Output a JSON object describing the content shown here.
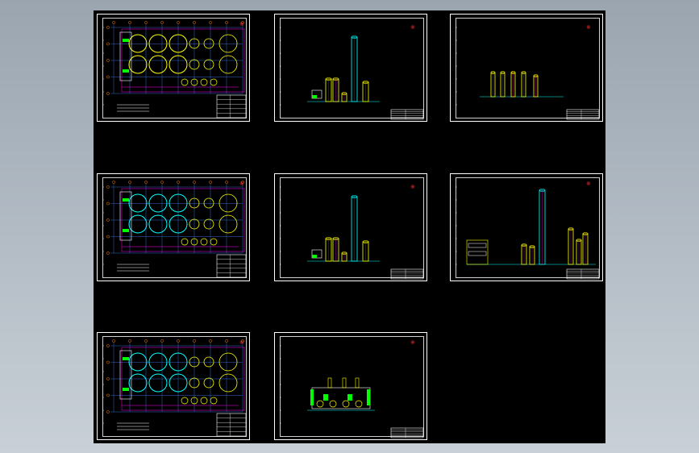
{
  "view": {
    "background": "#000000",
    "frame_color": "#ffffff",
    "accent_colors": [
      "#00ffff",
      "#ffff00",
      "#ff00ff",
      "#ff3333",
      "#00ff00",
      "#ffffff"
    ]
  },
  "sheets": [
    {
      "id": "s1",
      "kind": "plan-top",
      "col": 0,
      "row": 0
    },
    {
      "id": "s2",
      "kind": "elevation-towers",
      "col": 1,
      "row": 0
    },
    {
      "id": "s3",
      "kind": "elevation-small-towers",
      "col": 2,
      "row": 0
    },
    {
      "id": "s4",
      "kind": "plan-top",
      "col": 0,
      "row": 1
    },
    {
      "id": "s5",
      "kind": "elevation-towers",
      "col": 1,
      "row": 1
    },
    {
      "id": "s6",
      "kind": "elevation-wide",
      "col": 2,
      "row": 1
    },
    {
      "id": "s7",
      "kind": "plan-top",
      "col": 0,
      "row": 2
    },
    {
      "id": "s8",
      "kind": "section-green",
      "col": 1,
      "row": 2
    }
  ]
}
